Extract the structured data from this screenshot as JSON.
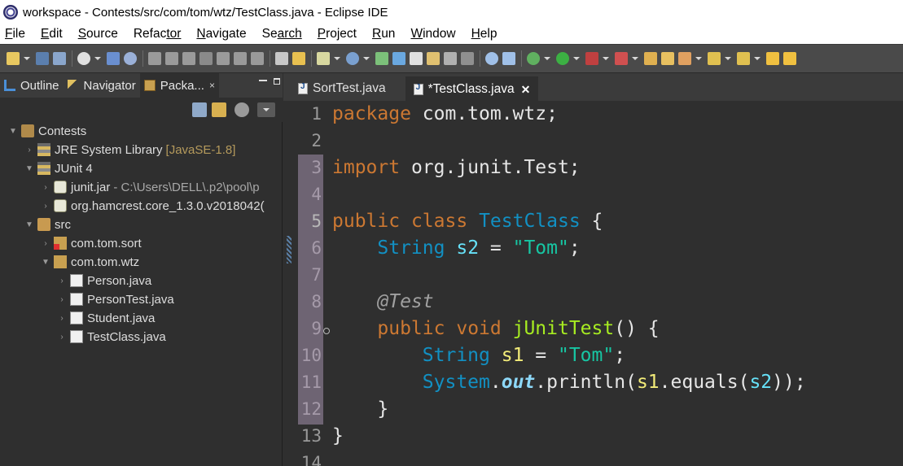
{
  "window": {
    "title": "workspace - Contests/src/com/tom/wtz/TestClass.java - Eclipse IDE"
  },
  "menubar": {
    "items": [
      {
        "mnemonic": "F",
        "rest": "ile"
      },
      {
        "mnemonic": "E",
        "rest": "dit"
      },
      {
        "mnemonic": "S",
        "rest": "ource"
      },
      {
        "mnemonic": "Refac",
        "rest": "tor",
        "underline_index": 5
      },
      {
        "mnemonic": "N",
        "rest": "avigate"
      },
      {
        "mnemonic": "Se",
        "rest": "arch",
        "underline_index": 2
      },
      {
        "mnemonic": "P",
        "rest": "roject"
      },
      {
        "mnemonic": "R",
        "rest": "un"
      },
      {
        "mnemonic": "W",
        "rest": "indow"
      },
      {
        "mnemonic": "H",
        "rest": "elp"
      }
    ]
  },
  "left_panel": {
    "tabs": [
      {
        "label": "Outline",
        "icon": "outline-icon"
      },
      {
        "label": "Navigator",
        "icon": "navigator-icon"
      },
      {
        "label": "Packa...",
        "icon": "package-explorer-icon",
        "active": true
      }
    ],
    "close_glyph": "×",
    "tree": [
      {
        "label": "Contests",
        "icon": "java-project-icon",
        "expanded": true,
        "level": 0
      },
      {
        "label": "JRE System Library",
        "decor": "[JavaSE-1.8]",
        "icon": "library-icon",
        "expanded": false,
        "level": 1
      },
      {
        "label": "JUnit 4",
        "icon": "library-icon",
        "expanded": true,
        "level": 1
      },
      {
        "label": "junit.jar",
        "decor_path": "- C:\\Users\\DELL\\.p2\\pool\\p",
        "icon": "jar-icon",
        "expanded": false,
        "level": 2
      },
      {
        "label": "org.hamcrest.core_1.3.0.v2018042(",
        "icon": "jar-icon",
        "expanded": false,
        "level": 2
      },
      {
        "label": "src",
        "icon": "source-folder-icon",
        "expanded": true,
        "level": 1
      },
      {
        "label": "com.tom.sort",
        "icon": "package-error-icon",
        "expanded": false,
        "level": 2
      },
      {
        "label": "com.tom.wtz",
        "icon": "package-icon",
        "expanded": true,
        "level": 2
      },
      {
        "label": "Person.java",
        "icon": "java-file-icon",
        "expanded": false,
        "level": 3
      },
      {
        "label": "PersonTest.java",
        "icon": "java-file-icon",
        "expanded": false,
        "level": 3
      },
      {
        "label": "Student.java",
        "icon": "java-file-icon",
        "expanded": false,
        "level": 3
      },
      {
        "label": "TestClass.java",
        "icon": "java-file-icon",
        "expanded": false,
        "level": 3
      }
    ]
  },
  "editor": {
    "tabs": [
      {
        "label": "SortTest.java",
        "active": false
      },
      {
        "label": "*TestClass.java",
        "active": true,
        "close": "✕"
      }
    ],
    "line_numbers": [
      "1",
      "2",
      "3",
      "4",
      "5",
      "6",
      "7",
      "8",
      "9",
      "10",
      "11",
      "12",
      "13",
      "14"
    ],
    "highlighted_lines": [
      3,
      4,
      5,
      6,
      7,
      8,
      9,
      10,
      11,
      12
    ],
    "code": {
      "l1": {
        "kw": "package",
        "rest": " com.tom.wtz;"
      },
      "l3": {
        "kw": "import",
        "rest": " org.junit.Test;"
      },
      "l5": {
        "kw1": "public",
        "kw2": "class",
        "type": "TestClass",
        "rest": " {"
      },
      "l6": {
        "type": "String",
        "field": "s2",
        "eq": " = ",
        "str": "\"Tom\"",
        "end": ";"
      },
      "l8": {
        "ann": "@Test"
      },
      "l9": {
        "kw1": "public",
        "kw2": "void",
        "method": "jUnitTest",
        "rest": "() {"
      },
      "l10": {
        "type": "String",
        "var": "s1",
        "eq": " = ",
        "str": "\"Tom\"",
        "end": ";"
      },
      "l11": {
        "type": "System",
        "dot1": ".",
        "sfield": "out",
        "dot2": ".",
        "call": "println",
        "p1": "(",
        "v1": "s1",
        "dot3": ".",
        "call2": "equals",
        "p2": "(",
        "v2": "s2",
        "end": "));"
      },
      "l12": {
        "brace": "}"
      },
      "l13": {
        "brace": "}"
      }
    }
  },
  "colors": {
    "keyword": "#cc7832",
    "type": "#1290c3",
    "string": "#17c6a3",
    "method": "#a7ec21",
    "field": "#66e1f8"
  }
}
